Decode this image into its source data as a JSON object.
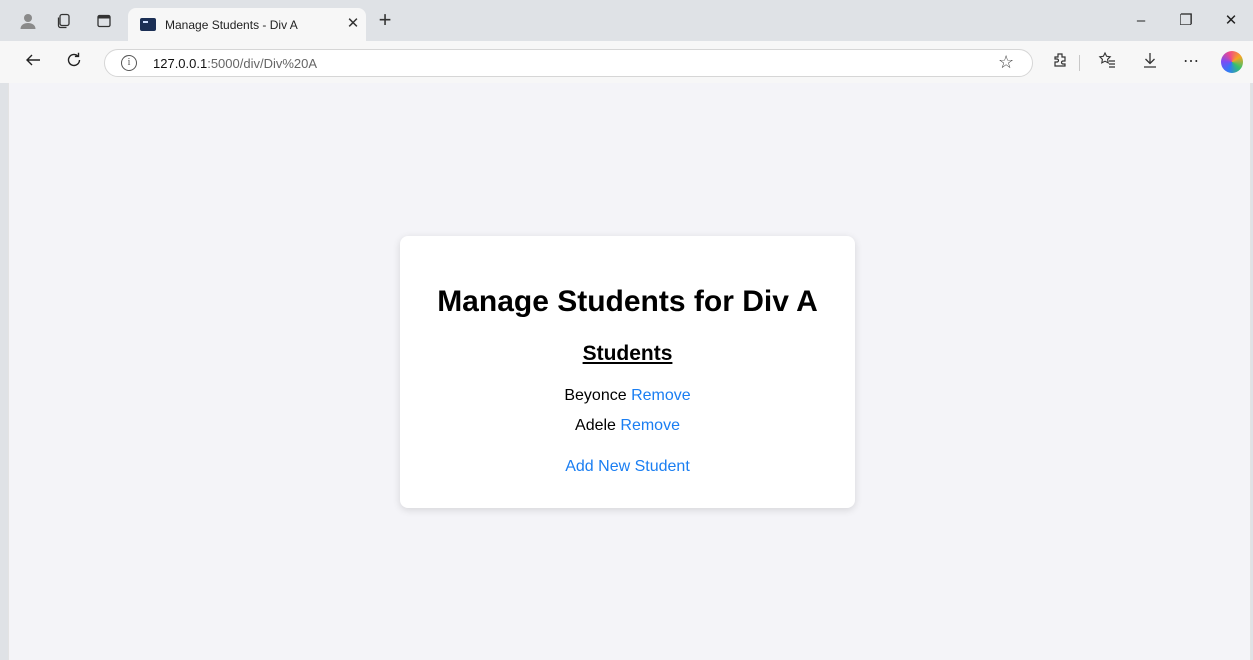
{
  "browser": {
    "tab": {
      "title": "Manage Students - Div A",
      "close_glyph": "✕"
    },
    "new_tab_glyph": "+",
    "window_controls": {
      "minimize": "–",
      "restore": "❐",
      "close": "✕"
    },
    "address": {
      "host": "127.0.0.1",
      "path": ":5000/div/Div%20A"
    },
    "icons": [
      "profile-icon",
      "workspaces-icon",
      "tab-actions-icon",
      "back-icon",
      "refresh-icon",
      "info-icon",
      "favorite-star-icon",
      "extensions-icon",
      "favorites-icon",
      "downloads-icon",
      "more-icon",
      "copilot-icon"
    ]
  },
  "page": {
    "heading": "Manage Students for Div A",
    "subheading": "Students",
    "students": [
      {
        "name": "Beyonce",
        "action": "Remove"
      },
      {
        "name": "Adele",
        "action": "Remove"
      }
    ],
    "add_link": "Add New Student"
  },
  "colors": {
    "link": "#1a7ef2",
    "page_bg": "#f4f4f8",
    "card_bg": "#ffffff"
  }
}
